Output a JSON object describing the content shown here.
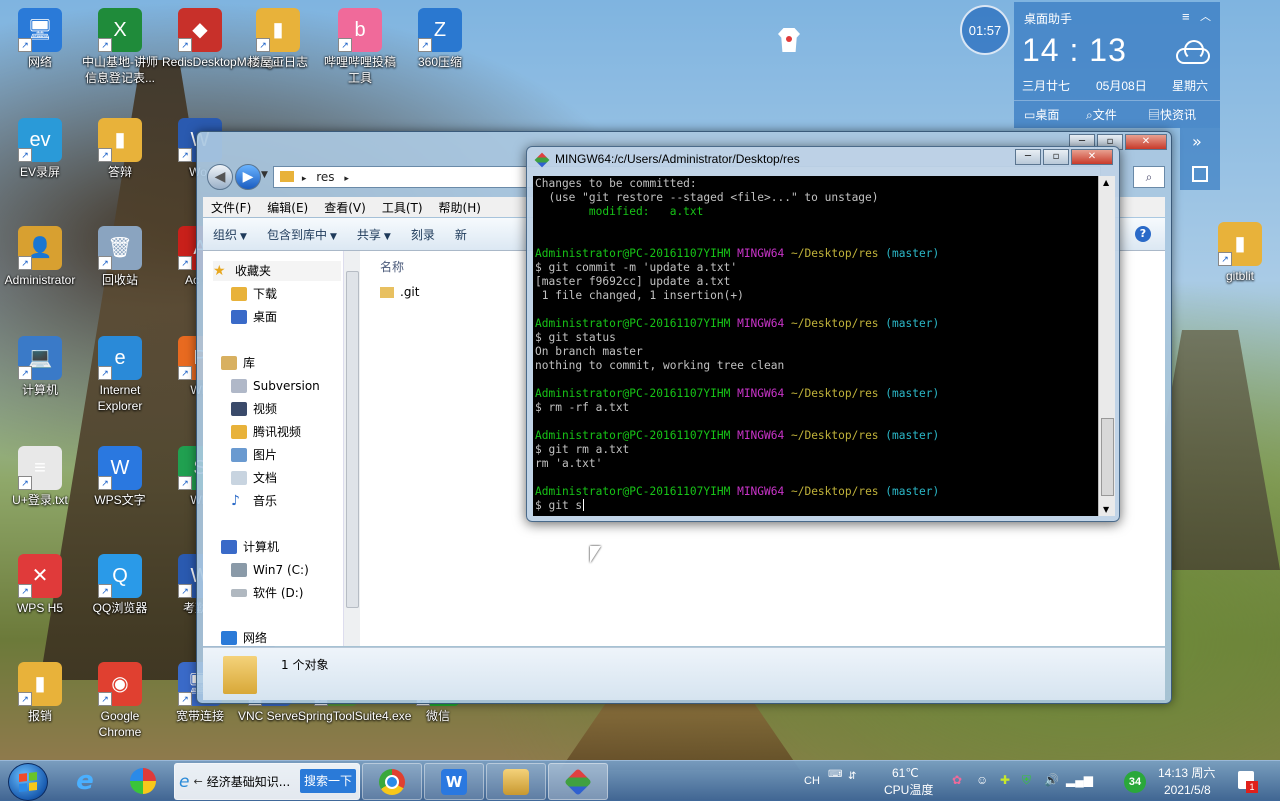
{
  "desktop_icons": [
    {
      "label": "网络",
      "color": "#2a7ad8",
      "glyph": "🖥"
    },
    {
      "label": "中山基地-讲师信息登记表...",
      "color": "#1f8b3a",
      "glyph": "X"
    },
    {
      "label": "RedisDesktopManager",
      "color": "#c8302a",
      "glyph": "◆"
    },
    {
      "label": "楼屋工日志",
      "color": "#e8b23a",
      "glyph": "▮"
    },
    {
      "label": "哔哩哔哩投稿工具",
      "color": "#f06a9a",
      "glyph": "b"
    },
    {
      "label": "360压缩",
      "color": "#2a78d0",
      "glyph": "Z"
    },
    {
      "label": "EV录屏",
      "color": "#2a9ad8",
      "glyph": "ev"
    },
    {
      "label": "答辩",
      "color": "#e8b23a",
      "glyph": "▮"
    },
    {
      "label": "Wor",
      "color": "#2a5ab0",
      "glyph": "W"
    },
    {
      "label": "Administrator",
      "color": "#d8a030",
      "glyph": "👤"
    },
    {
      "label": "回收站",
      "color": "#8aa4c0",
      "glyph": "🗑"
    },
    {
      "label": "Ac Cr",
      "color": "#c8201a",
      "glyph": "A"
    },
    {
      "label": "计算机",
      "color": "#3a7ac8",
      "glyph": "💻"
    },
    {
      "label": "Internet Explorer",
      "color": "#2a8ad8",
      "glyph": "e"
    },
    {
      "label": "WP",
      "color": "#e86a20",
      "glyph": "P"
    },
    {
      "label": "U+登录.txt",
      "color": "#e8e8e8",
      "glyph": "≡"
    },
    {
      "label": "WPS文字",
      "color": "#2a78e0",
      "glyph": "W"
    },
    {
      "label": "WP",
      "color": "#20a050",
      "glyph": "S"
    },
    {
      "label": "WPS H5",
      "color": "#e03a3a",
      "glyph": "✕"
    },
    {
      "label": "QQ浏览器",
      "color": "#2a9ae8",
      "glyph": "Q"
    },
    {
      "label": "考勤 d",
      "color": "#2a5ab0",
      "glyph": "W"
    },
    {
      "label": "报销",
      "color": "#e8b23a",
      "glyph": "▮"
    },
    {
      "label": "Google Chrome",
      "color": "#e04030",
      "glyph": "◉"
    },
    {
      "label": "宽带连接",
      "color": "#3a6ac8",
      "glyph": "🖥"
    },
    {
      "label": "VNC Server",
      "color": "#3a6ac8",
      "glyph": "V"
    },
    {
      "label": "SpringToolSuite4.exe",
      "color": "#5a9a3a",
      "glyph": "S"
    },
    {
      "label": "微信",
      "color": "#20b030",
      "glyph": "◔"
    },
    {
      "label": "gitblit",
      "color": "#e8b23a",
      "glyph": "▮"
    }
  ],
  "clock_badge": "01:57",
  "widget": {
    "title": "桌面助手",
    "time": "14 : 13",
    "lunar": "三月廿七",
    "date": "05月08日",
    "weekday": "星期六",
    "links": [
      "桌面",
      "文件",
      "快资讯"
    ]
  },
  "explorer": {
    "breadcrumb": "res",
    "menu": [
      "文件(F)",
      "编辑(E)",
      "查看(V)",
      "工具(T)",
      "帮助(H)"
    ],
    "toolbar": [
      "组织",
      "包含到库中",
      "共享",
      "刻录",
      "新"
    ],
    "nav": {
      "favorites": "收藏夹",
      "favorites_items": [
        "下载",
        "桌面"
      ],
      "libraries": "库",
      "library_items": [
        "Subversion",
        "视频",
        "腾讯视频",
        "图片",
        "文档",
        "音乐"
      ],
      "computer": "计算机",
      "drives": [
        "Win7 (C:)",
        "软件 (D:)"
      ],
      "network": "网络"
    },
    "column_header": "名称",
    "files": [
      ".git"
    ],
    "status": "1 个对象"
  },
  "terminal": {
    "title": "MINGW64:/c/Users/Administrator/Desktop/res",
    "prompt_user": "Administrator@PC-20161107YIHM",
    "prompt_env": "MINGW64",
    "prompt_path": "~/Desktop/res",
    "prompt_branch": "(master)",
    "head_lines": [
      "Changes to be committed:",
      "  (use \"git restore --staged <file>...\" to unstage)"
    ],
    "modified_line": "        modified:   a.txt",
    "blocks": [
      {
        "cmd": "$ git commit -m 'update a.txt'",
        "out": [
          "[master f9692cc] update a.txt",
          " 1 file changed, 1 insertion(+)"
        ]
      },
      {
        "cmd": "$ git status",
        "out": [
          "On branch master",
          "nothing to commit, working tree clean"
        ]
      },
      {
        "cmd": "$ rm -rf a.txt",
        "out": []
      },
      {
        "cmd": "$ git rm a.txt",
        "out": [
          "rm 'a.txt'"
        ]
      },
      {
        "cmd": "$ git s",
        "out": []
      }
    ]
  },
  "taskbar": {
    "ie_task_label": "经济基础知识...",
    "search_btn": "搜索一下",
    "ime": "CH",
    "temp": "61℃",
    "temp_label": "CPU温度",
    "badge": "34",
    "time": "14:13 周六",
    "date": "2021/5/8",
    "notify_count": "1"
  }
}
